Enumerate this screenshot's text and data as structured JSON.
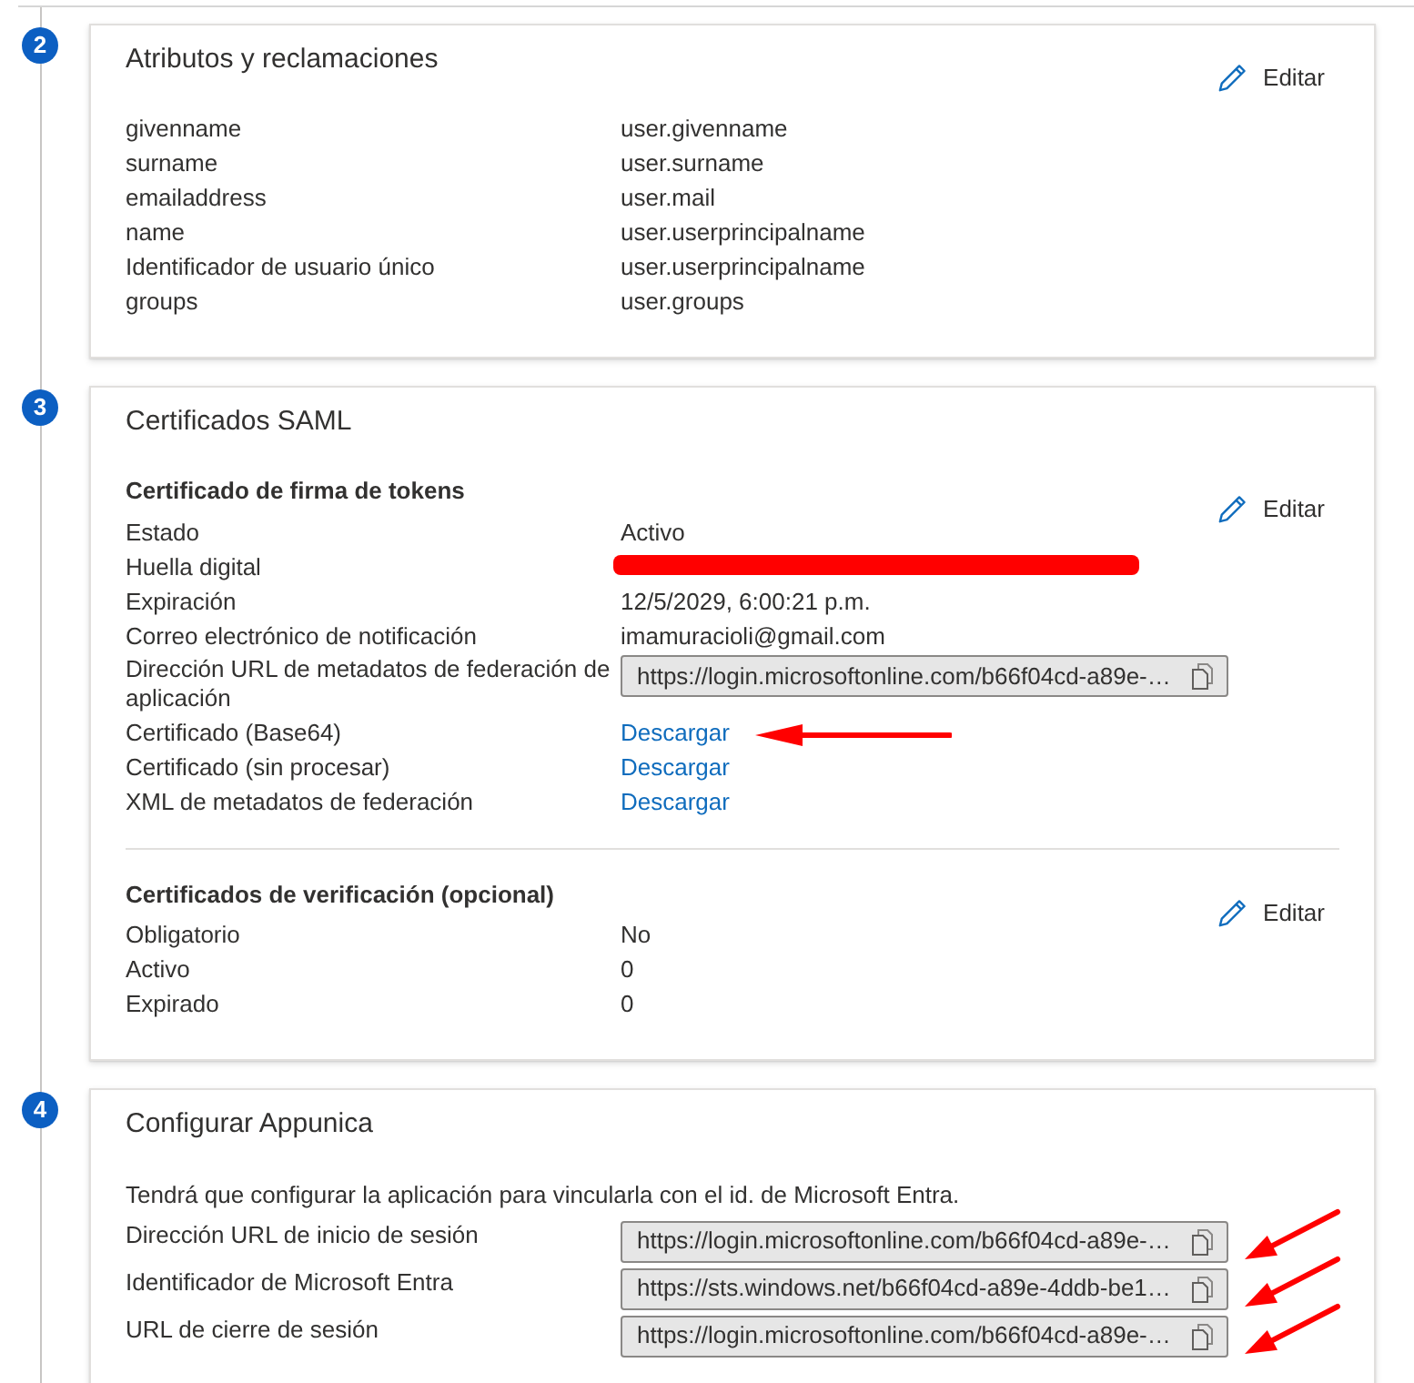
{
  "steps": [
    {
      "number": "2",
      "title": "Atributos y reclamaciones",
      "edit_label": "Editar",
      "sections": [
        {
          "rows": [
            {
              "kind": "text",
              "label": "givenname",
              "value": "user.givenname"
            },
            {
              "kind": "text",
              "label": "surname",
              "value": "user.surname"
            },
            {
              "kind": "text",
              "label": "emailaddress",
              "value": "user.mail"
            },
            {
              "kind": "text",
              "label": "name",
              "value": "user.userprincipalname"
            },
            {
              "kind": "text",
              "label": "Identificador de usuario único",
              "value": "user.userprincipalname"
            },
            {
              "kind": "text",
              "label": "groups",
              "value": "user.groups"
            }
          ]
        }
      ]
    },
    {
      "number": "3",
      "title": "Certificados SAML",
      "sections": [
        {
          "heading": "Certificado de firma de tokens",
          "edit_label": "Editar",
          "rows": [
            {
              "kind": "text",
              "label": "Estado",
              "value": "Activo",
              "arrow": false
            },
            {
              "kind": "redacted",
              "label": "Huella digital",
              "arrow": false
            },
            {
              "kind": "text",
              "label": "Expiración",
              "value": "12/5/2029, 6:00:21 p.m.",
              "arrow": false
            },
            {
              "kind": "text",
              "label": "Correo electrónico de notificación",
              "value": "imamuracioli@gmail.com",
              "arrow": false
            },
            {
              "kind": "field",
              "label": "Dirección URL de metadatos de federación de aplicación",
              "value": "https://login.microsoftonline.com/b66f04cd-a89e-…",
              "arrow": false
            },
            {
              "kind": "link",
              "label": "Certificado (Base64)",
              "value": "Descargar",
              "arrow": true
            },
            {
              "kind": "link",
              "label": "Certificado (sin procesar)",
              "value": "Descargar",
              "arrow": false
            },
            {
              "kind": "link",
              "label": "XML de metadatos de federación",
              "value": "Descargar",
              "arrow": false
            }
          ]
        },
        {
          "heading": "Certificados de verificación (opcional)",
          "edit_label": "Editar",
          "rows": [
            {
              "kind": "text",
              "label": "Obligatorio",
              "value": "No"
            },
            {
              "kind": "text",
              "label": "Activo",
              "value": "0"
            },
            {
              "kind": "text",
              "label": "Expirado",
              "value": "0"
            }
          ]
        }
      ]
    },
    {
      "number": "4",
      "title": "Configurar Appunica",
      "description": "Tendrá que configurar la aplicación para vincularla con el id. de Microsoft Entra.",
      "sections": [
        {
          "rows": [
            {
              "kind": "field",
              "label": "Dirección URL de inicio de sesión",
              "value": "https://login.microsoftonline.com/b66f04cd-a89e-…",
              "arrow": true
            },
            {
              "kind": "field",
              "label": "Identificador de Microsoft Entra",
              "value": "https://sts.windows.net/b66f04cd-a89e-4ddb-be1…",
              "arrow": true
            },
            {
              "kind": "field",
              "label": "URL de cierre de sesión",
              "value": "https://login.microsoftonline.com/b66f04cd-a89e-…",
              "arrow": true
            }
          ]
        }
      ]
    }
  ]
}
